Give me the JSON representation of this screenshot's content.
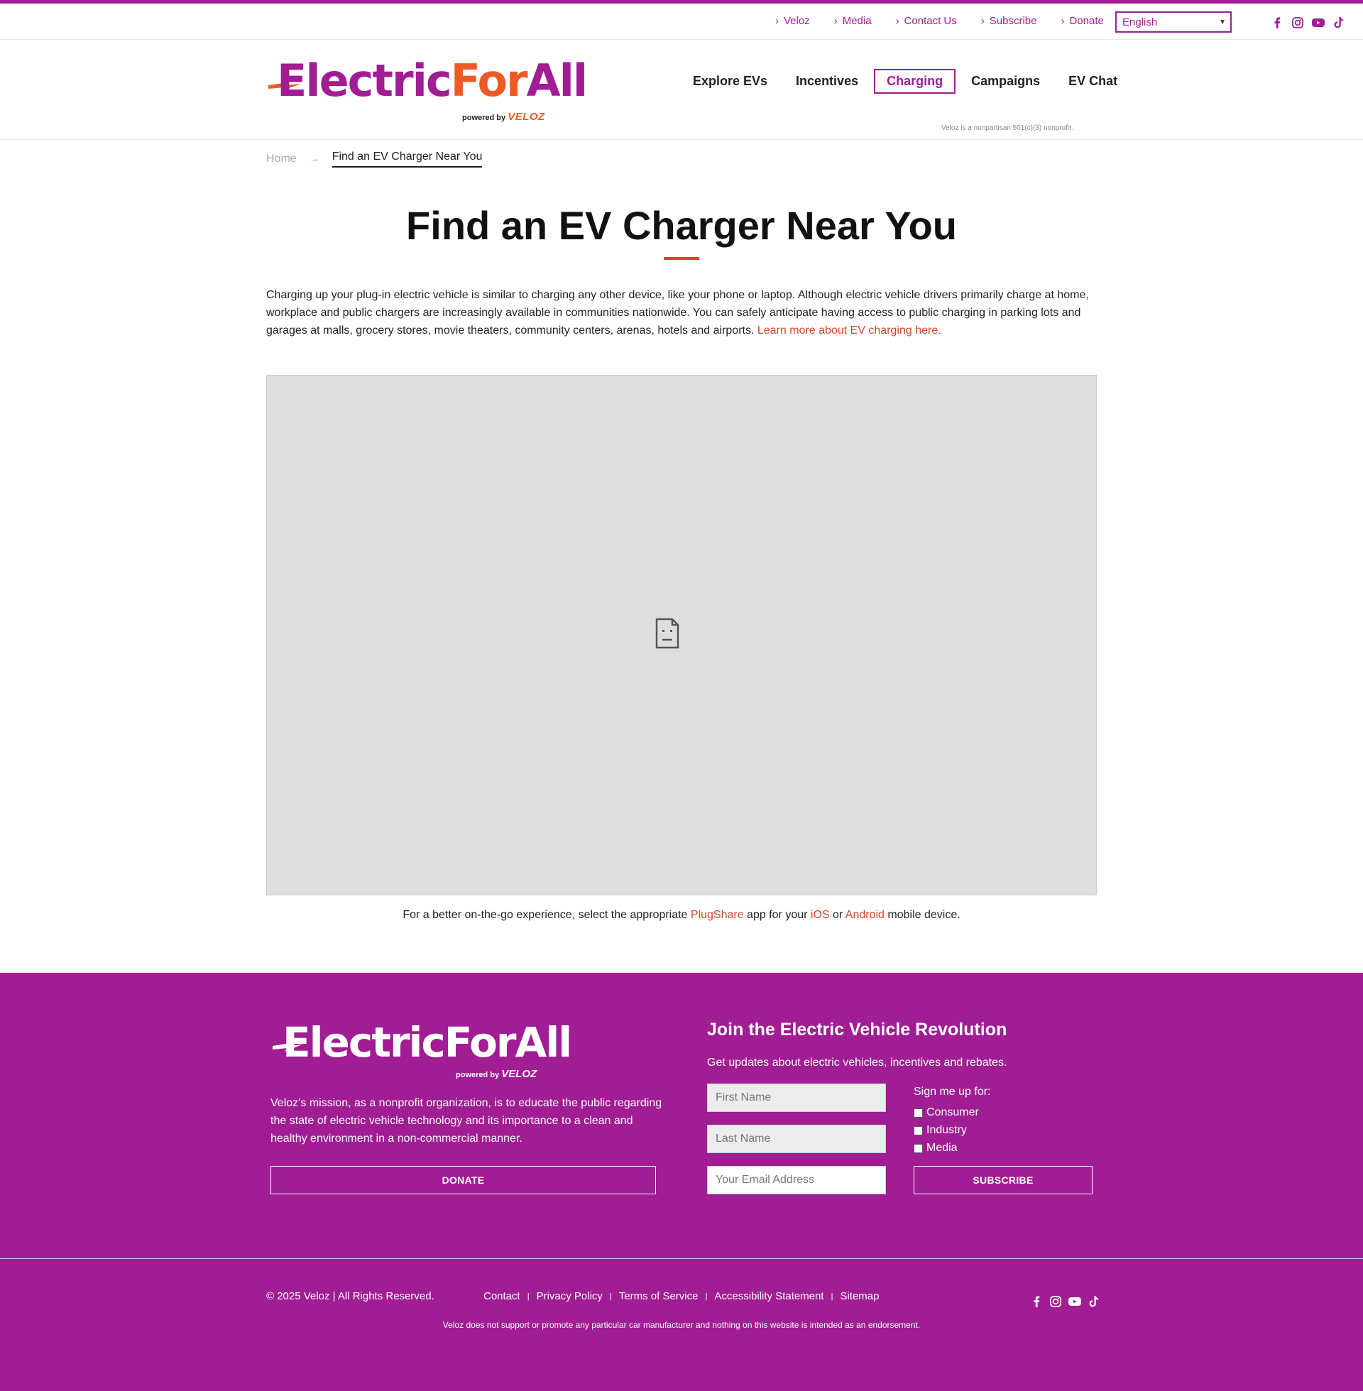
{
  "colors": {
    "brand_purple": "#a01d94",
    "brand_orange": "#ef5a24",
    "link_red": "#d9452b"
  },
  "utility_nav": {
    "links": [
      "Veloz",
      "Media",
      "Contact Us",
      "Subscribe",
      "Donate"
    ],
    "language": "English",
    "social_icons": [
      "facebook-icon",
      "instagram-icon",
      "youtube-icon",
      "tiktok-icon"
    ]
  },
  "header": {
    "logo": {
      "electric": "Electric",
      "for": "For",
      "all": "All",
      "powered_by": "powered by",
      "veloz": "VELOZ"
    },
    "nav": [
      "Explore EVs",
      "Incentives",
      "Charging",
      "Campaigns",
      "EV Chat"
    ],
    "active_nav": "Charging",
    "nonprofit_note": "Veloz is a nonpartisan 501(c)(3) nonprofit."
  },
  "breadcrumb": {
    "home": "Home",
    "arrow": "→",
    "current": "Find an EV Charger Near You"
  },
  "page": {
    "title": "Find an EV Charger Near You",
    "intro_text": "Charging up your plug-in electric vehicle is similar to charging any other device, like your phone or laptop. Although electric vehicle drivers primarily charge at home, workplace and public chargers are increasingly available in communities nationwide. You can safely anticipate having access to public charging in parking lots and garages at malls, grocery stores, movie theaters, community centers, arenas, hotels and airports. ",
    "intro_link": "Learn more about EV charging here.",
    "app_note": {
      "before": "For a better on-the-go experience, select the appropriate ",
      "plugshare": "PlugShare",
      "middle": " app for your ",
      "ios": "iOS",
      "or": " or ",
      "android": "Android",
      "after": " mobile device."
    }
  },
  "footer": {
    "logo": {
      "text": "ElectricForAll",
      "powered_by": "powered by",
      "veloz": "VELOZ"
    },
    "mission": "Veloz’s mission, as a nonprofit organization, is to educate the public regarding the state of electric vehicle technology and its importance to a clean and healthy environment in a non-commercial manner.",
    "donate_label": "DONATE",
    "join_title": "Join the Electric Vehicle Revolution",
    "join_subtitle": "Get updates about electric vehicles, incentives and rebates.",
    "first_name_placeholder": "First Name",
    "last_name_placeholder": "Last Name",
    "email_placeholder": "Your Email Address",
    "signup_label": "Sign me up for:",
    "signup_options": [
      "Consumer",
      "Industry",
      "Media"
    ],
    "subscribe_label": "SUBSCRIBE",
    "copyright": "© 2025 Veloz | All Rights Reserved.",
    "links": [
      "Contact",
      "Privacy Policy",
      "Terms of Service",
      "Accessibility Statement",
      "Sitemap"
    ],
    "separator": "|",
    "disclaimer": "Veloz does not support or promote any particular car manufacturer and nothing on this website is intended as an endorsement."
  }
}
